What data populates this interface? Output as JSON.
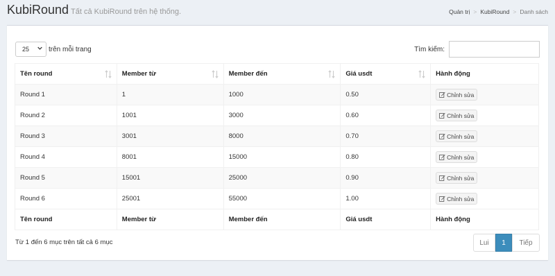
{
  "header": {
    "title": "KubiRound",
    "subtitle": "Tất cả KubiRound trên hệ thống."
  },
  "breadcrumb": [
    "Quản trị",
    "KubiRound",
    "Danh sách"
  ],
  "length": {
    "value": "25",
    "label": "trên mỗi trang"
  },
  "search": {
    "label": "Tìm kiếm:",
    "value": ""
  },
  "table": {
    "columns": [
      "Tên round",
      "Member từ",
      "Member đến",
      "Giá usdt",
      "Hành động"
    ],
    "rows": [
      {
        "name": "Round 1",
        "from": "1",
        "to": "1000",
        "price": "0.50",
        "action": "Chỉnh sửa"
      },
      {
        "name": "Round 2",
        "from": "1001",
        "to": "3000",
        "price": "0.60",
        "action": "Chỉnh sửa"
      },
      {
        "name": "Round 3",
        "from": "3001",
        "to": "8000",
        "price": "0.70",
        "action": "Chỉnh sửa"
      },
      {
        "name": "Round 4",
        "from": "8001",
        "to": "15000",
        "price": "0.80",
        "action": "Chỉnh sửa"
      },
      {
        "name": "Round 5",
        "from": "15001",
        "to": "25000",
        "price": "0.90",
        "action": "Chỉnh sửa"
      },
      {
        "name": "Round 6",
        "from": "25001",
        "to": "55000",
        "price": "1.00",
        "action": "Chỉnh sửa"
      }
    ]
  },
  "info": "Từ 1 đến 6 mục trên tất cả 6 mục",
  "pagination": {
    "prev": "Lui",
    "current": "1",
    "next": "Tiếp"
  },
  "colors": {
    "accent": "#3c8dbc",
    "background": "#ecf0f5"
  },
  "icons": {
    "sort": "sort-icon",
    "edit": "edit-icon",
    "dropdown": "chevron-down-icon"
  }
}
